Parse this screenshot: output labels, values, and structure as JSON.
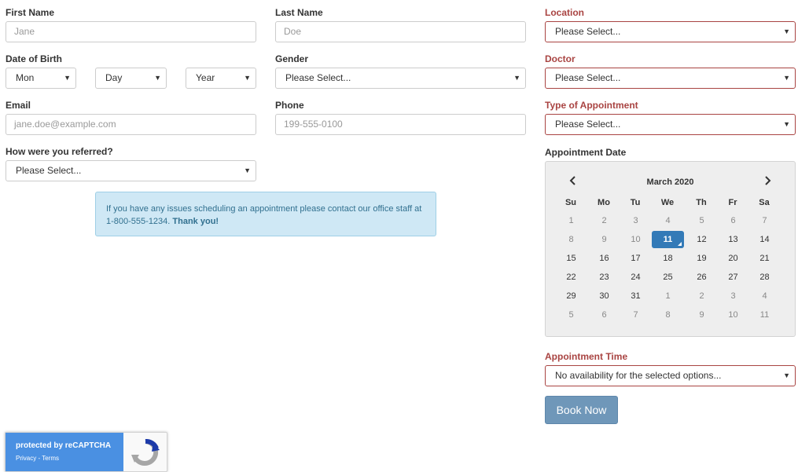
{
  "form": {
    "first_name": {
      "label": "First Name",
      "placeholder": "Jane"
    },
    "last_name": {
      "label": "Last Name",
      "placeholder": "Doe"
    },
    "location": {
      "label": "Location",
      "value": "Please Select..."
    },
    "dob": {
      "label": "Date of Birth",
      "month": "Mon",
      "day": "Day",
      "year": "Year"
    },
    "gender": {
      "label": "Gender",
      "value": "Please Select..."
    },
    "doctor": {
      "label": "Doctor",
      "value": "Please Select..."
    },
    "email": {
      "label": "Email",
      "placeholder": "jane.doe@example.com"
    },
    "phone": {
      "label": "Phone",
      "placeholder": "199-555-0100"
    },
    "appointment_type": {
      "label": "Type of Appointment",
      "value": "Please Select..."
    },
    "referred": {
      "label": "How were you referred?",
      "value": "Please Select..."
    },
    "appointment_date": {
      "label": "Appointment Date"
    },
    "appointment_time": {
      "label": "Appointment Time",
      "value": "No availability for the selected options..."
    },
    "book_button": "Book Now"
  },
  "alert": {
    "text": "If you have any issues scheduling an appointment please contact our office staff at 1-800-555-1234.",
    "bold": "Thank you!"
  },
  "calendar": {
    "title": "March 2020",
    "prev_icon": "chevron-left-icon",
    "next_icon": "chevron-right-icon",
    "weekdays": [
      "Su",
      "Mo",
      "Tu",
      "We",
      "Th",
      "Fr",
      "Sa"
    ],
    "weeks": [
      [
        "1",
        "2",
        "3",
        "4",
        "5",
        "6",
        "7"
      ],
      [
        "8",
        "9",
        "10",
        "11",
        "12",
        "13",
        "14"
      ],
      [
        "15",
        "16",
        "17",
        "18",
        "19",
        "20",
        "21"
      ],
      [
        "22",
        "23",
        "24",
        "25",
        "26",
        "27",
        "28"
      ],
      [
        "29",
        "30",
        "31",
        "1",
        "2",
        "3",
        "4"
      ],
      [
        "5",
        "6",
        "7",
        "8",
        "9",
        "10",
        "11"
      ]
    ],
    "selected": "11"
  },
  "recaptcha": {
    "line1": "protected by reCAPTCHA",
    "privacy": "Privacy",
    "separator": " - ",
    "terms": "Terms",
    "icon": "recaptcha-logo-icon"
  },
  "colors": {
    "error": "#a94442",
    "selected_day": "#337ab7",
    "button": "#6f97b9",
    "alert_bg": "#cfe8f5",
    "recaptcha": "#4a90e2"
  }
}
